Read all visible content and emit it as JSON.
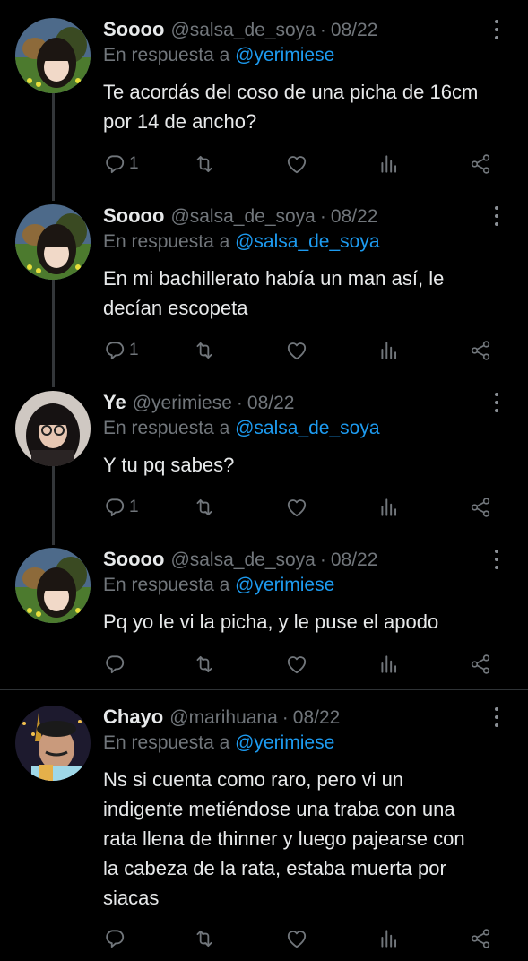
{
  "tweets": [
    {
      "name": "Soooo",
      "handle": "@salsa_de_soya",
      "date": "08/22",
      "reply_prefix": "En respuesta a",
      "reply_to": "@yerimiese",
      "lines": [
        "Te acordás del coso de una picha de 16cm",
        "por 14 de ancho?"
      ],
      "reply_count": "1"
    },
    {
      "name": "Soooo",
      "handle": "@salsa_de_soya",
      "date": "08/22",
      "reply_prefix": "En respuesta a",
      "reply_to": "@salsa_de_soya",
      "lines": [
        "En mi bachillerato había un man así, le",
        "decían escopeta"
      ],
      "reply_count": "1"
    },
    {
      "name": "Ye",
      "handle": "@yerimiese",
      "date": "08/22",
      "reply_prefix": "En respuesta a",
      "reply_to": "@salsa_de_soya",
      "lines": [
        "Y tu pq sabes?"
      ],
      "reply_count": "1"
    },
    {
      "name": "Soooo",
      "handle": "@salsa_de_soya",
      "date": "08/22",
      "reply_prefix": "En respuesta a",
      "reply_to": "@yerimiese",
      "lines": [
        "Pq yo le vi la picha, y le puse el apodo"
      ],
      "reply_count": ""
    },
    {
      "name": "Chayo",
      "handle": "@marihuana",
      "date": "08/22",
      "reply_prefix": "En respuesta a",
      "reply_to": "@yerimiese",
      "lines": [
        "Ns si cuenta como raro, pero vi un",
        "indigente metiéndose una traba con una",
        "rata llena de thinner y luego pajearse con",
        "la cabeza de la rata, estaba muerta por",
        "siacas"
      ],
      "reply_count": ""
    }
  ],
  "separator": "·",
  "icons": {
    "reply": "reply-icon",
    "retweet": "retweet-icon",
    "like": "heart-icon",
    "views": "analytics-icon",
    "share": "share-icon",
    "more": "more-options-icon"
  },
  "colors": {
    "background": "#000000",
    "text": "#e7e9ea",
    "muted": "#71767b",
    "link": "#1d9bf0"
  }
}
